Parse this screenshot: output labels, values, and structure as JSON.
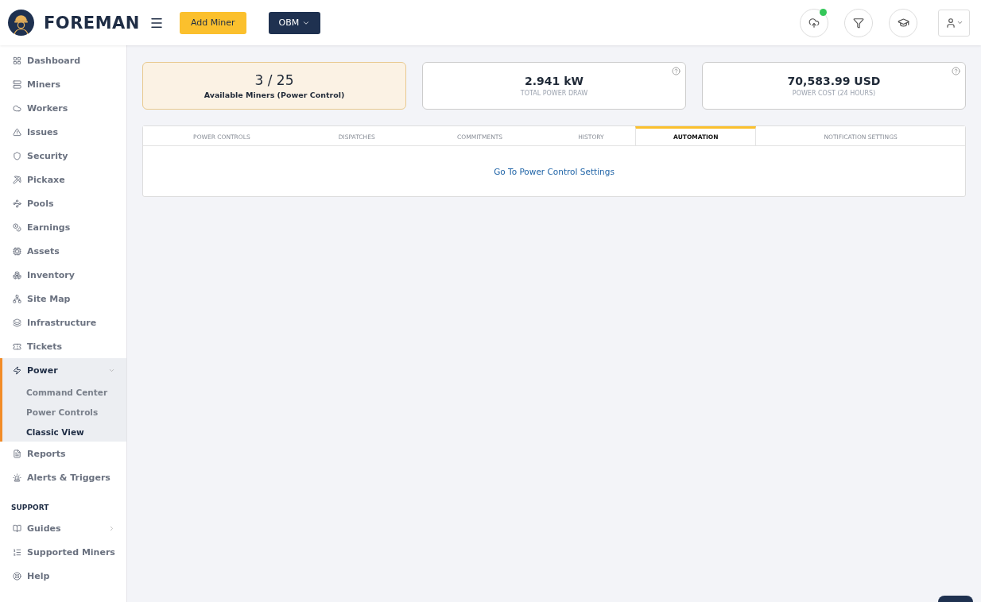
{
  "header": {
    "brand": "FOREMAN",
    "add_button": "Add Miner",
    "org_button": "OBM",
    "upload_status": {
      "color": "#34c759"
    }
  },
  "sidebar": {
    "sections": [
      {
        "items": [
          {
            "label": "Dashboard",
            "selected": false
          },
          {
            "label": "Miners",
            "selected": false
          },
          {
            "label": "Workers",
            "selected": false
          },
          {
            "label": "Issues",
            "selected": false
          },
          {
            "label": "Security",
            "selected": false
          },
          {
            "label": "Pickaxe",
            "selected": false
          },
          {
            "label": "Pools",
            "selected": false
          },
          {
            "label": "Earnings",
            "selected": false
          },
          {
            "label": "Assets",
            "selected": false
          },
          {
            "label": "Inventory",
            "selected": false
          },
          {
            "label": "Site Map",
            "selected": false
          },
          {
            "label": "Infrastructure",
            "selected": false
          },
          {
            "label": "Tickets",
            "selected": false
          },
          {
            "label": "Power",
            "selected": true,
            "expanded": true,
            "children": [
              {
                "label": "Command Center",
                "selected": false
              },
              {
                "label": "Power Controls",
                "selected": false
              },
              {
                "label": "Classic View",
                "selected": true
              }
            ]
          },
          {
            "label": "Reports",
            "selected": false
          },
          {
            "label": "Alerts & Triggers",
            "selected": false
          }
        ]
      },
      {
        "title": "SUPPORT",
        "items": [
          {
            "label": "Guides",
            "selected": false,
            "expanded": false
          },
          {
            "label": "Supported Miners",
            "selected": false
          },
          {
            "label": "Help",
            "selected": false
          }
        ]
      }
    ]
  },
  "stats": [
    {
      "value": "3 / 25",
      "label": "Available Miners (Power Control)",
      "kind": "highlight"
    },
    {
      "value": "2.941 kW",
      "label": "TOTAL POWER DRAW",
      "kind": "help"
    },
    {
      "value": "70,583.99 USD",
      "label": "POWER COST (24 HOURS)",
      "kind": "help"
    }
  ],
  "tabs": [
    {
      "label": "POWER CONTROLS",
      "selected": false
    },
    {
      "label": "DISPATCHES",
      "selected": false
    },
    {
      "label": "COMMITMENTS",
      "selected": false
    },
    {
      "label": "HISTORY",
      "selected": false
    },
    {
      "label": "AUTOMATION",
      "selected": true
    },
    {
      "label": "NOTIFICATION SETTINGS",
      "selected": false
    }
  ],
  "panel": {
    "link": "Go To Power Control Settings"
  }
}
